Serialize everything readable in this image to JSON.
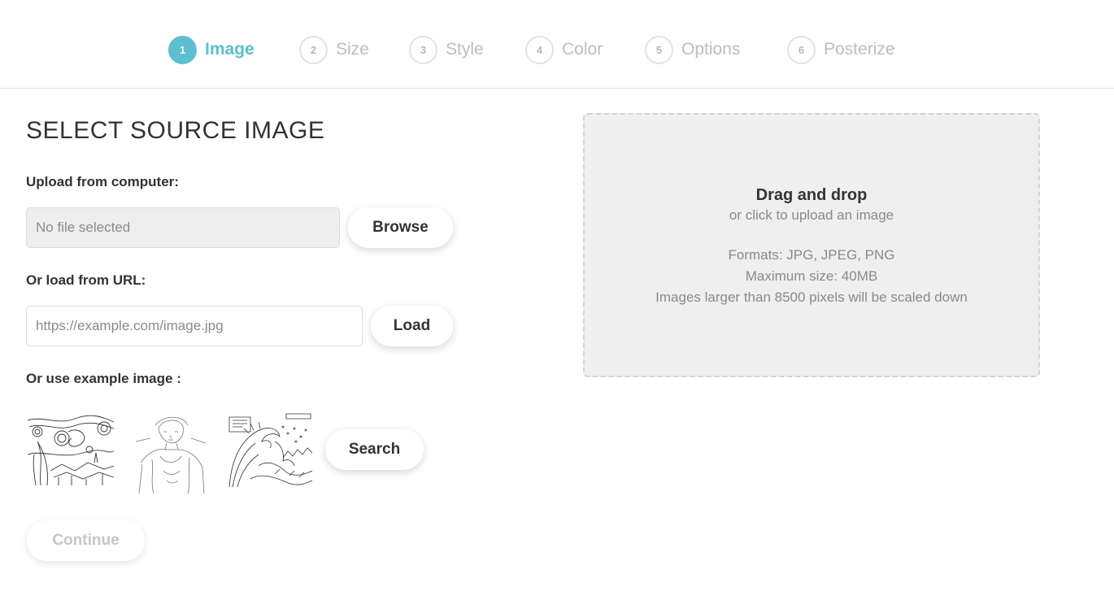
{
  "steps": [
    {
      "number": "1",
      "label": "Image"
    },
    {
      "number": "2",
      "label": "Size"
    },
    {
      "number": "3",
      "label": "Style"
    },
    {
      "number": "4",
      "label": "Color"
    },
    {
      "number": "5",
      "label": "Options"
    },
    {
      "number": "6",
      "label": "Posterize"
    }
  ],
  "active_step": "Image",
  "accent_color": "#5cbfcf",
  "page_title": "SELECT SOURCE IMAGE",
  "upload": {
    "label": "Upload from computer:",
    "file_status": "No file selected",
    "browse_label": "Browse"
  },
  "url": {
    "label": "Or load from URL:",
    "placeholder": "https://example.com/image.jpg",
    "value": "",
    "load_label": "Load"
  },
  "examples": {
    "label": "Or use example image :",
    "images": [
      "starry-night-sketch",
      "woman-portrait-sketch",
      "great-wave-sketch"
    ],
    "search_label": "Search"
  },
  "continue_label": "Continue",
  "dropzone": {
    "title": "Drag and drop",
    "subtitle": "or click to upload an image",
    "formats": "Formats: JPG, JPEG, PNG",
    "max_size": "Maximum size: 40MB",
    "scale_note": "Images larger than 8500 pixels will be scaled down"
  }
}
